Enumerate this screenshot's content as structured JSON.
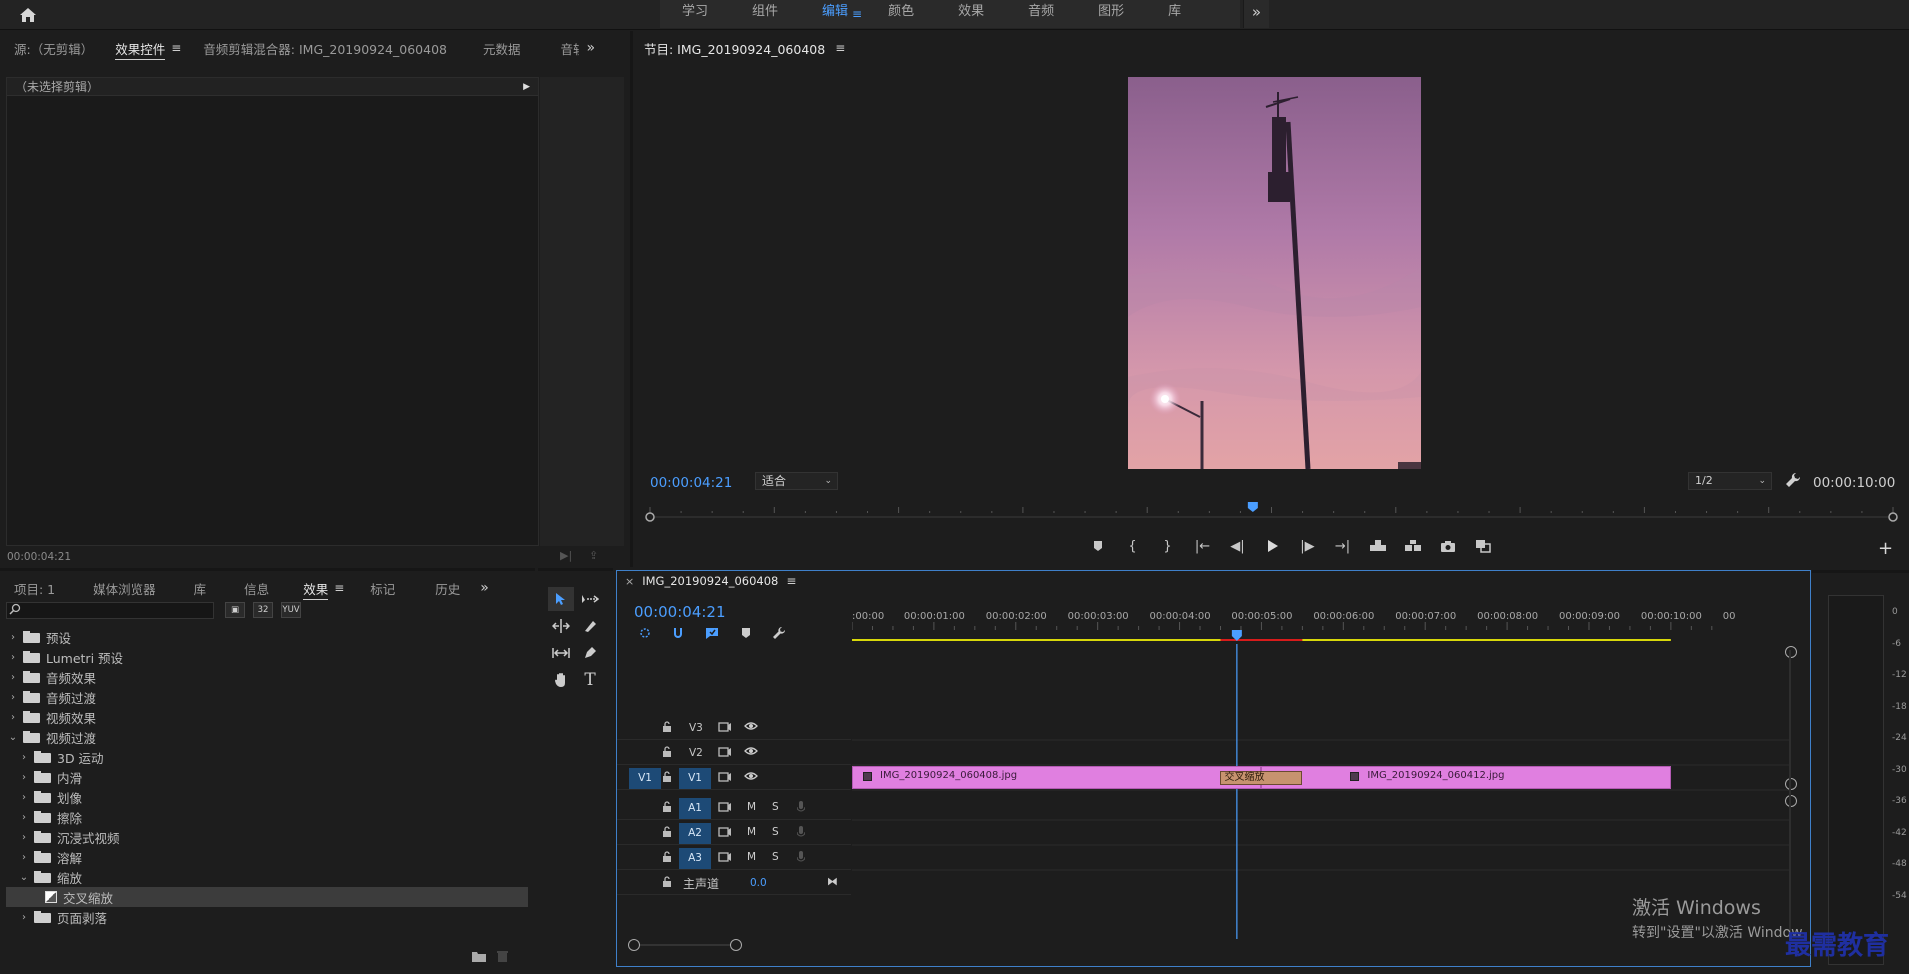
{
  "workspaces": {
    "items": [
      {
        "label": "学习",
        "active": false
      },
      {
        "label": "组件",
        "active": false
      },
      {
        "label": "编辑",
        "active": true
      },
      {
        "label": "颜色",
        "active": false
      },
      {
        "label": "效果",
        "active": false
      },
      {
        "label": "音频",
        "active": false
      },
      {
        "label": "图形",
        "active": false
      },
      {
        "label": "库",
        "active": false
      }
    ],
    "menu_glyph": "≡",
    "more_glyph": "»"
  },
  "source_panel": {
    "tabs": [
      "源:（无剪辑）",
      "效果控件",
      "音频剪辑混合器: IMG_20190924_060408",
      "元数据",
      "音轨"
    ],
    "active_tab": "效果控件",
    "hamburger": "≡",
    "overflow": "»",
    "no_clip_text": "（未选择剪辑）",
    "timecode": "00:00:04:21"
  },
  "program_monitor": {
    "title": "节目: IMG_20190924_060408",
    "hamburger": "≡",
    "timecode": "00:00:04:21",
    "fit": "适合",
    "resolution": "1/2",
    "duration": "00:00:10:00",
    "playhead_fraction": 0.485
  },
  "project_panel": {
    "tabs": [
      "项目: 1",
      "媒体浏览器",
      "库",
      "信息",
      "效果",
      "标记",
      "历史"
    ],
    "active_tab": "效果",
    "hamburger": "≡",
    "overflow": "»",
    "search_placeholder": "",
    "tree": [
      {
        "level": 0,
        "expanded": false,
        "type": "folder",
        "label": "预设",
        "selected": false
      },
      {
        "level": 0,
        "expanded": false,
        "type": "folder",
        "label": "Lumetri 预设",
        "selected": false
      },
      {
        "level": 0,
        "expanded": false,
        "type": "folder",
        "label": "音频效果",
        "selected": false
      },
      {
        "level": 0,
        "expanded": false,
        "type": "folder",
        "label": "音频过渡",
        "selected": false
      },
      {
        "level": 0,
        "expanded": false,
        "type": "folder",
        "label": "视频效果",
        "selected": false
      },
      {
        "level": 0,
        "expanded": true,
        "type": "folder",
        "label": "视频过渡",
        "selected": false
      },
      {
        "level": 1,
        "expanded": false,
        "type": "folder",
        "label": "3D 运动",
        "selected": false
      },
      {
        "level": 1,
        "expanded": false,
        "type": "folder",
        "label": "内滑",
        "selected": false
      },
      {
        "level": 1,
        "expanded": false,
        "type": "folder",
        "label": "划像",
        "selected": false
      },
      {
        "level": 1,
        "expanded": false,
        "type": "folder",
        "label": "擦除",
        "selected": false
      },
      {
        "level": 1,
        "expanded": false,
        "type": "folder",
        "label": "沉浸式视频",
        "selected": false
      },
      {
        "level": 1,
        "expanded": false,
        "type": "folder",
        "label": "溶解",
        "selected": false
      },
      {
        "level": 1,
        "expanded": true,
        "type": "folder",
        "label": "缩放",
        "selected": false
      },
      {
        "level": 2,
        "expanded": false,
        "type": "effect",
        "label": "交叉缩放",
        "selected": true
      },
      {
        "level": 1,
        "expanded": false,
        "type": "folder",
        "label": "页面剥落",
        "selected": false
      }
    ]
  },
  "timeline": {
    "sequence_name": "IMG_20190924_060408",
    "hamburger": "≡",
    "close": "×",
    "timecode": "00:00:04:21",
    "ruler_labels": [
      ":00:00",
      "00:00:01:00",
      "00:00:02:00",
      "00:00:03:00",
      "00:00:04:00",
      "00:00:05:00",
      "00:00:06:00",
      "00:00:07:00",
      "00:00:08:00",
      "00:00:09:00",
      "00:00:10:00",
      "00"
    ],
    "playhead_seconds": 4.7,
    "tracks": [
      {
        "id": "V3",
        "kind": "video",
        "targeted": false
      },
      {
        "id": "V2",
        "kind": "video",
        "targeted": false
      },
      {
        "id": "V1",
        "kind": "video",
        "targeted": true,
        "source_patch": "V1"
      },
      {
        "id": "A1",
        "kind": "audio",
        "targeted": true
      },
      {
        "id": "A2",
        "kind": "audio",
        "targeted": true
      },
      {
        "id": "A3",
        "kind": "audio",
        "targeted": true
      }
    ],
    "mute_label": "M",
    "solo_label": "S",
    "master": {
      "label": "主声道",
      "value": "0.0"
    },
    "clips": [
      {
        "name": "IMG_20190924_060408.jpg",
        "start": 0.0,
        "end": 5.0
      },
      {
        "name": "IMG_20190924_060412.jpg",
        "start": 5.0,
        "end": 10.0
      }
    ],
    "transition": {
      "name": "交叉缩放",
      "start": 4.5,
      "end": 5.5
    },
    "clip_color": "#e07fe0"
  },
  "audio_meter": {
    "scale": [
      "0",
      "-6",
      "-12",
      "-18",
      "-24",
      "-30",
      "-36",
      "-42",
      "-48",
      "-54"
    ]
  },
  "activation": {
    "title": "激活 Windows",
    "subtitle": "转到\"设置\"以激活 Windows。"
  },
  "watermark": "最需教育",
  "colors": {
    "accent": "#4b9eff",
    "clip": "#e07fe0",
    "transition": "#c7936f",
    "track_target": "#1d4a76"
  }
}
